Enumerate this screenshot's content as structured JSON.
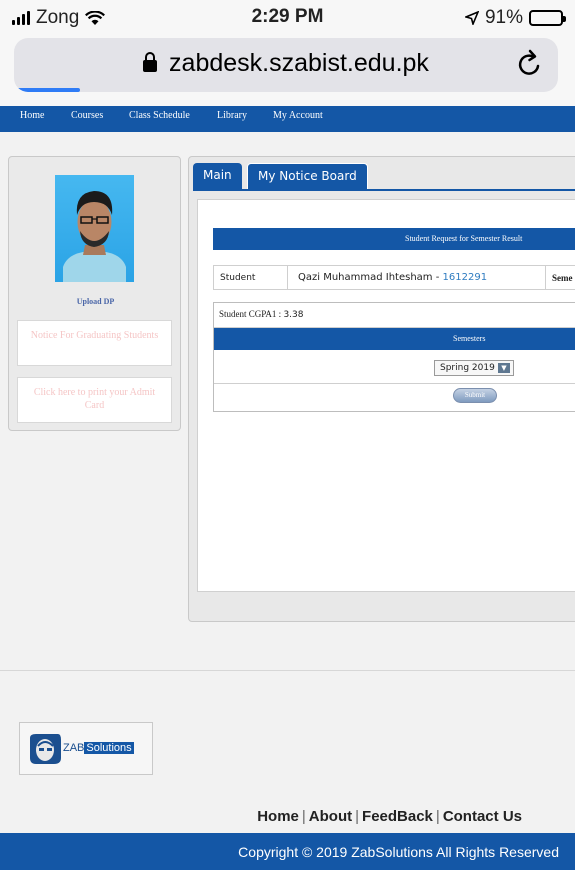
{
  "status": {
    "carrier": "Zong",
    "time": "2:29 PM",
    "battery": "91%",
    "battery_level": 0.91
  },
  "browser": {
    "url": "zabdesk.szabist.edu.pk"
  },
  "nav": {
    "items": [
      "Home",
      "Courses",
      "Class Schedule",
      "Library",
      "My Account"
    ]
  },
  "sidebar": {
    "upload_dp": "Upload DP",
    "notice": "Notice For Graduating Students",
    "admit_card": "Click here to print your Admit Card"
  },
  "tabs": {
    "main": "Main",
    "notice_board": "My Notice Board"
  },
  "form": {
    "title": "Student Request for Semester Result",
    "student_label": "Student",
    "student_name": "Qazi Muhammad Ihtesham",
    "student_dash": " - ",
    "student_id": "1612291",
    "semester_cut": "Seme",
    "cgpa_label": "Student CGPA1 : ",
    "cgpa_value": "3.38",
    "semesters_header": "Semesters",
    "semester_selected": "Spring 2019",
    "submit": "Submit"
  },
  "footer": {
    "logo_prefix": "ZAB",
    "logo_suffix": "Solutions",
    "links": [
      "Home",
      "About",
      "FeedBack",
      "Contact Us"
    ],
    "copyright": "Copyright © 2019 ZabSolutions All Rights Reserved"
  },
  "colors": {
    "primary": "#1457a6",
    "link": "#2f7cc0",
    "muted_pink": "#f5c6c6"
  }
}
